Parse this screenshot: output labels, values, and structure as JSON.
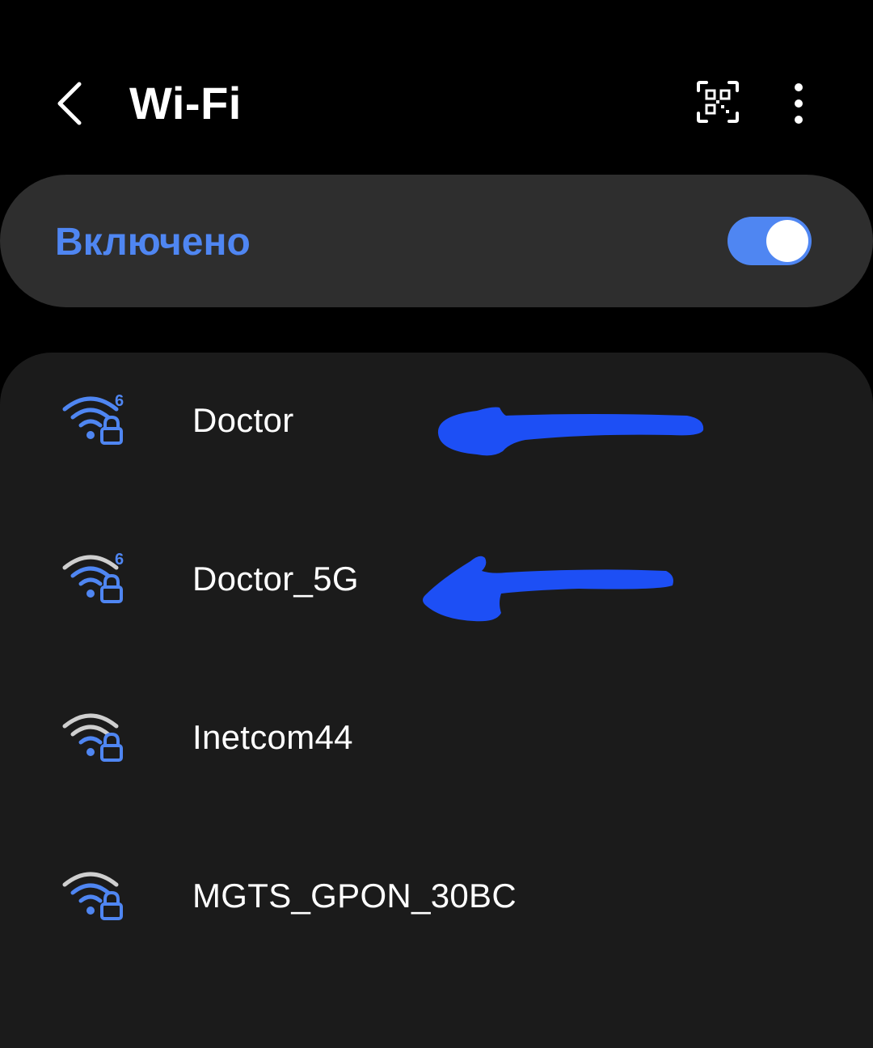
{
  "header": {
    "back_icon": "chevron-left-icon",
    "title": "Wi-Fi",
    "qr_icon": "qr-scan-icon",
    "more_icon": "more-vertical-icon"
  },
  "wifi_toggle": {
    "label": "Включено",
    "state": "on"
  },
  "networks": [
    {
      "name": "Doctor",
      "wifi6": true,
      "secured": true,
      "signal": 4
    },
    {
      "name": "Doctor_5G",
      "wifi6": true,
      "secured": true,
      "signal": 3
    },
    {
      "name": "Inetcom44",
      "wifi6": false,
      "secured": true,
      "signal": 2
    },
    {
      "name": "MGTS_GPON_30BC",
      "wifi6": false,
      "secured": true,
      "signal": 3
    }
  ],
  "annotations": {
    "color": "#1d4ff5",
    "targets": [
      "Doctor",
      "Doctor_5G"
    ]
  },
  "colors": {
    "background": "#000000",
    "card": "#2e2e2e",
    "list_card": "#1b1b1b",
    "accent": "#4f86f2",
    "icon_inactive": "#cfcfcf",
    "text": "#ffffff"
  }
}
